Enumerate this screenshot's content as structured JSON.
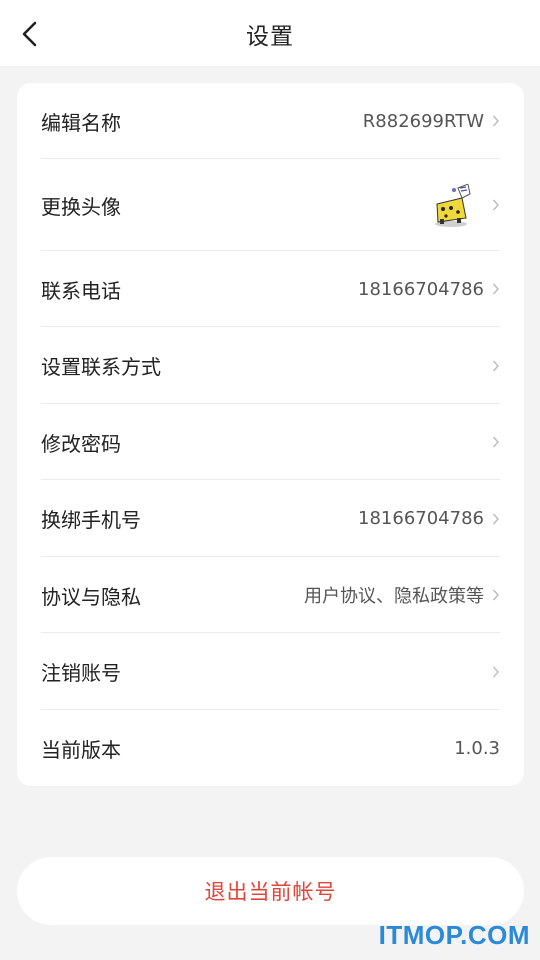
{
  "header": {
    "title": "设置",
    "back_icon": "chevron-left-icon"
  },
  "settings": {
    "items": [
      {
        "label": "编辑名称",
        "value": "R882699RTW",
        "has_chevron": true
      },
      {
        "label": "更换头像",
        "value": "",
        "has_avatar": true,
        "has_chevron": true
      },
      {
        "label": "联系电话",
        "value": "18166704786",
        "has_chevron": true
      },
      {
        "label": "设置联系方式",
        "value": "",
        "has_chevron": true
      },
      {
        "label": "修改密码",
        "value": "",
        "has_chevron": true
      },
      {
        "label": "换绑手机号",
        "value": "18166704786",
        "has_chevron": true
      },
      {
        "label": "协议与隐私",
        "value": "用户协议、隐私政策等",
        "has_chevron": true
      },
      {
        "label": "注销账号",
        "value": "",
        "has_chevron": true
      },
      {
        "label": "当前版本",
        "value": "1.0.3",
        "has_chevron": false
      }
    ]
  },
  "logout": {
    "label": "退出当前帐号"
  },
  "watermark": {
    "text": "ITMOP.COM"
  },
  "colors": {
    "accent": "#e0453a",
    "background": "#f3f3f3",
    "card": "#ffffff",
    "watermark": "#2b8ad8"
  }
}
